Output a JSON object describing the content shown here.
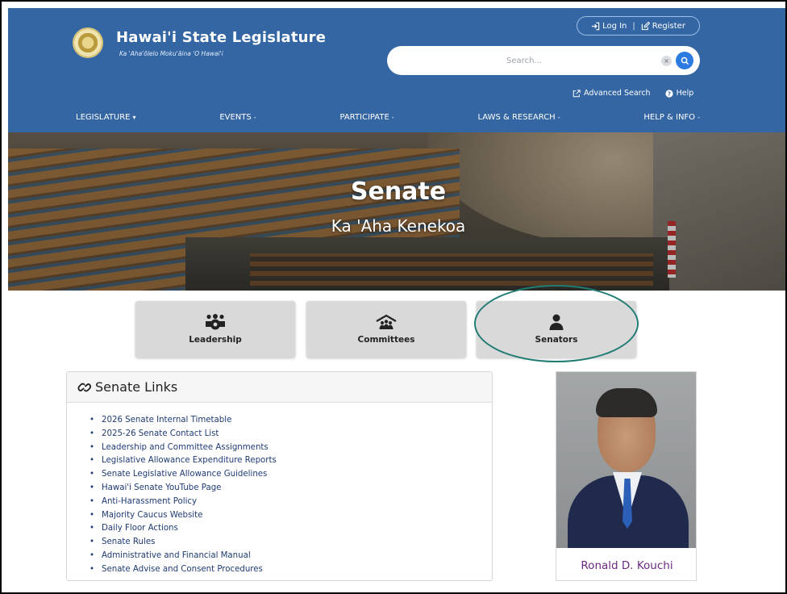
{
  "header": {
    "site_title": "Hawai'i State Legislature",
    "site_subtitle": "Ka 'Aha'ōlelo Moku'āina 'O Hawai'i",
    "login_label": "Log In",
    "separator": "|",
    "register_label": "Register",
    "search_placeholder": "Search...",
    "clear_label": "×",
    "advanced_search_label": "Advanced Search",
    "help_label": "Help"
  },
  "nav": {
    "items": [
      {
        "label": "LEGISLATURE"
      },
      {
        "label": "EVENTS"
      },
      {
        "label": "PARTICIPATE"
      },
      {
        "label": "LAWS & RESEARCH"
      },
      {
        "label": "HELP & INFO"
      }
    ],
    "caret_first": "▾",
    "caret_rest": "-"
  },
  "hero": {
    "title": "Senate",
    "subtitle": "Ka 'Aha Kenekoa"
  },
  "tiles": [
    {
      "label": "Leadership",
      "icon": "people-group-icon"
    },
    {
      "label": "Committees",
      "icon": "committee-house-icon"
    },
    {
      "label": "Senators",
      "icon": "person-icon"
    }
  ],
  "senate_links": {
    "heading": "Senate Links",
    "items": [
      "2026 Senate Internal Timetable",
      "2025-26 Senate Contact List",
      "Leadership and Committee Assignments",
      "Legislative Allowance Expenditure Reports",
      "Senate Legislative Allowance Guidelines",
      "Hawai'i Senate YouTube Page",
      "Anti-Harassment Policy",
      "Majority Caucus Website",
      "Daily Floor Actions",
      "Senate Rules",
      "Administrative and Financial Manual",
      "Senate Advise and Consent Procedures"
    ]
  },
  "senator": {
    "name": "Ronald D. Kouchi"
  },
  "colors": {
    "header_bg": "#3466a4",
    "tile_bg": "#d9d9d9",
    "link_color": "#1f3b74",
    "senator_name": "#6a2a82",
    "annotation_circle": "#1f7b73",
    "search_button": "#2b7be0"
  }
}
